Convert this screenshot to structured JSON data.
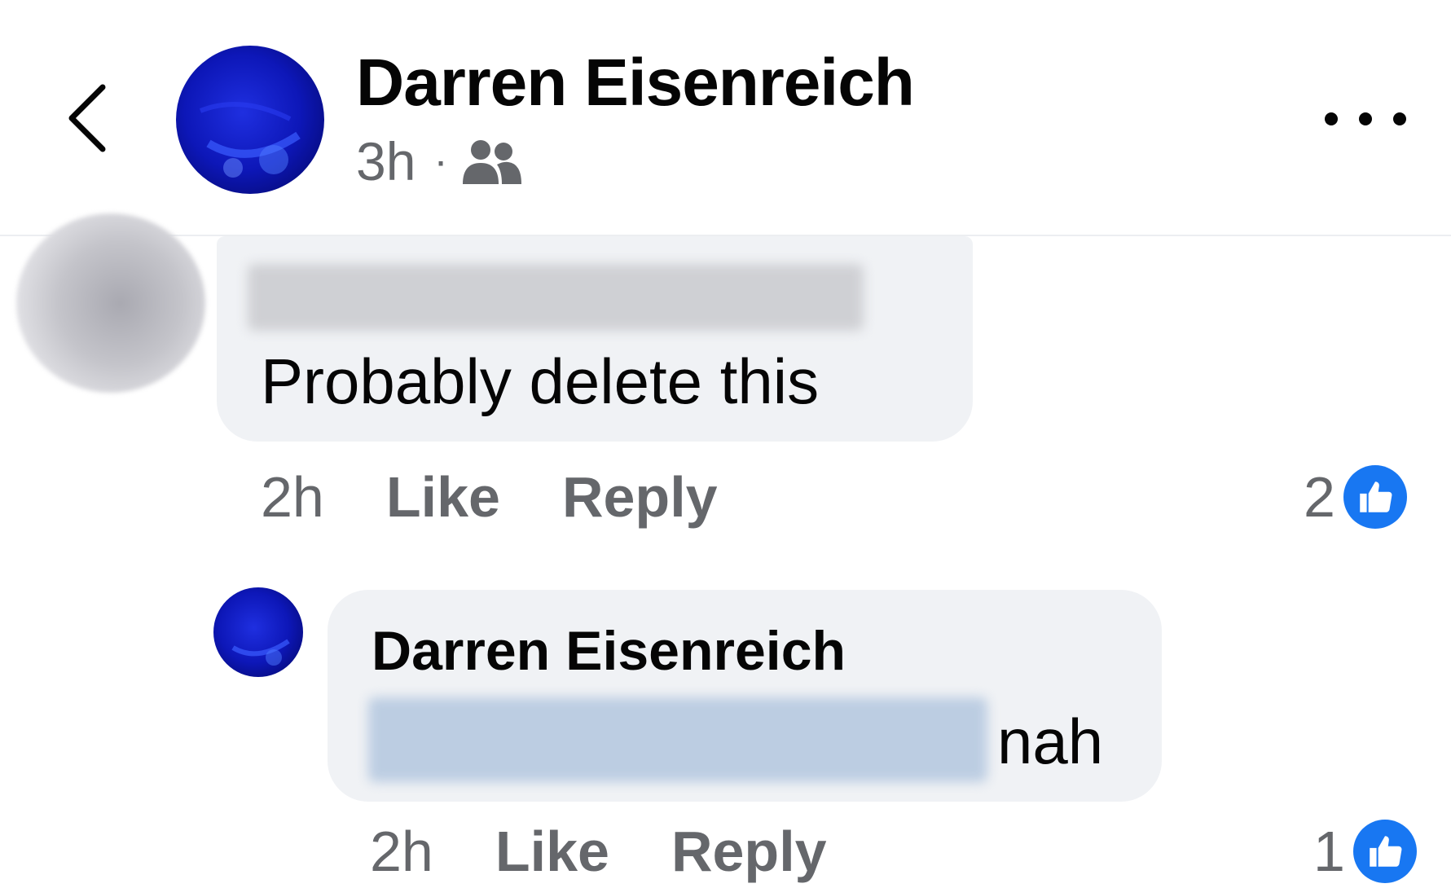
{
  "post_header": {
    "author_name": "Darren Eisenreich",
    "time": "3h",
    "separator": "·",
    "audience_icon": "friends-icon"
  },
  "comments": [
    {
      "author_name": "",
      "text": "Probably delete this",
      "time": "2h",
      "like_label": "Like",
      "reply_label": "Reply",
      "reaction_count": "2",
      "reaction_icon": "like-reaction-icon"
    },
    {
      "author_name": "Darren Eisenreich",
      "text": "nah",
      "time": "2h",
      "like_label": "Like",
      "reply_label": "Reply",
      "reaction_count": "1",
      "reaction_icon": "like-reaction-icon"
    }
  ],
  "icons": {
    "back": "chevron-left-icon",
    "more": "more-options-icon"
  },
  "colors": {
    "accent": "#1877f2",
    "bubble_bg": "#f0f2f5",
    "secondary_text": "#65676b",
    "primary_text": "#050505"
  }
}
